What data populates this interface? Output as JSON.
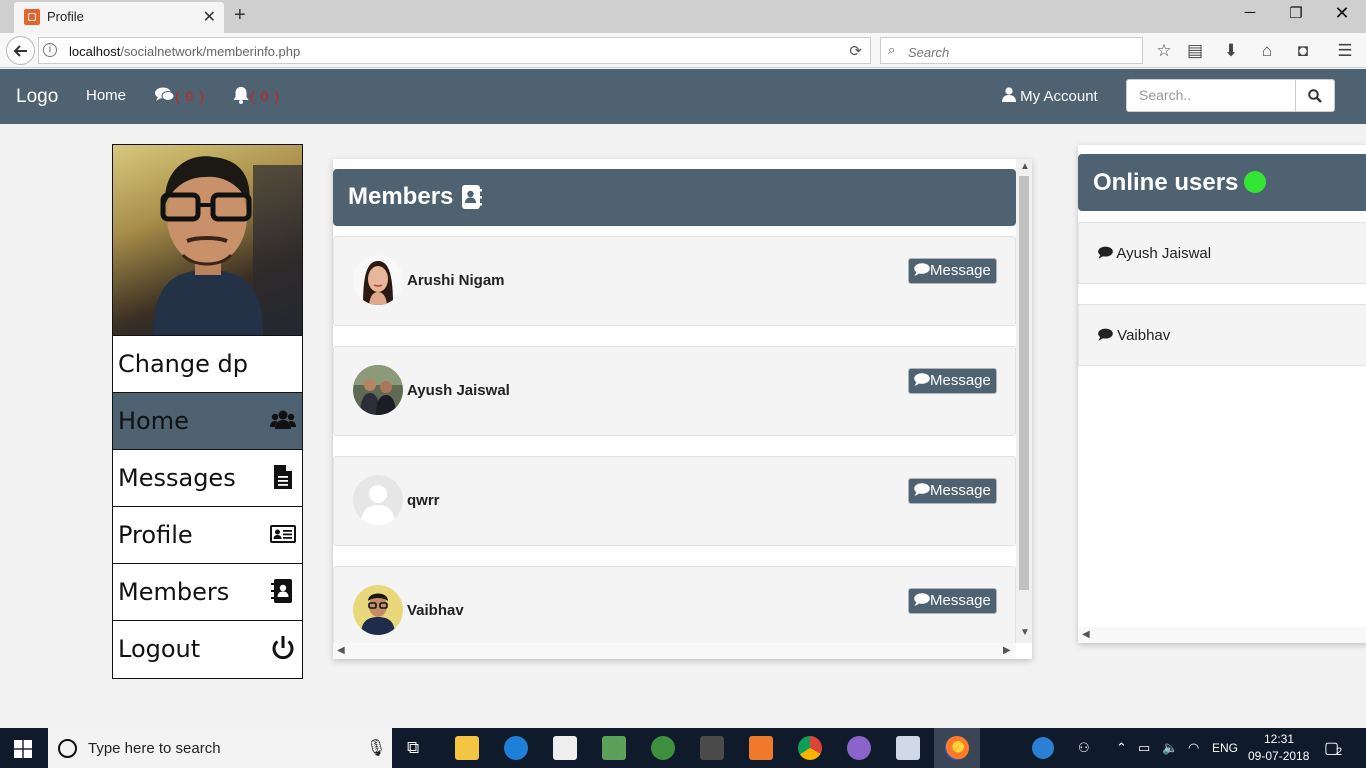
{
  "browser": {
    "tab_title": "Profile",
    "tab_close": "✕",
    "new_tab": "+",
    "url_host": "localhost",
    "url_path": "/socialnetwork/memberinfo.php",
    "search_placeholder": "Search",
    "window_controls": {
      "minimize": "─",
      "maximize": "❐",
      "close": "✕"
    }
  },
  "site_nav": {
    "logo": "Logo",
    "home": "Home",
    "messages_count": "( 0 )",
    "notifications_count": "( 0 )",
    "account": "My Account",
    "search_placeholder": "Search.."
  },
  "sidebar": {
    "items": [
      {
        "label": "Change dp",
        "icon": ""
      },
      {
        "label": "Home",
        "icon": "users-icon"
      },
      {
        "label": "Messages",
        "icon": "document-icon"
      },
      {
        "label": "Profile",
        "icon": "id-card-icon"
      },
      {
        "label": "Members",
        "icon": "address-book-icon"
      },
      {
        "label": "Logout",
        "icon": "power-icon"
      }
    ]
  },
  "members": {
    "title": "Members",
    "button_label": "Message",
    "list": [
      {
        "name": "Arushi Nigam",
        "avatar": "photo-woman"
      },
      {
        "name": "Ayush Jaiswal",
        "avatar": "photo-group"
      },
      {
        "name": "qwrr",
        "avatar": "default-silhouette"
      },
      {
        "name": "Vaibhav",
        "avatar": "photo-man"
      }
    ]
  },
  "online": {
    "title": "Online users",
    "users": [
      {
        "name": "Ayush Jaiswal"
      },
      {
        "name": "Vaibhav"
      }
    ]
  },
  "taskbar": {
    "search_placeholder": "Type here to search",
    "language": "ENG",
    "time": "12:31",
    "date": "09-07-2018",
    "notification_count": "2"
  },
  "colors": {
    "header": "#4f6271",
    "online_dot": "#33e633",
    "count_red": "#d21f1f"
  }
}
